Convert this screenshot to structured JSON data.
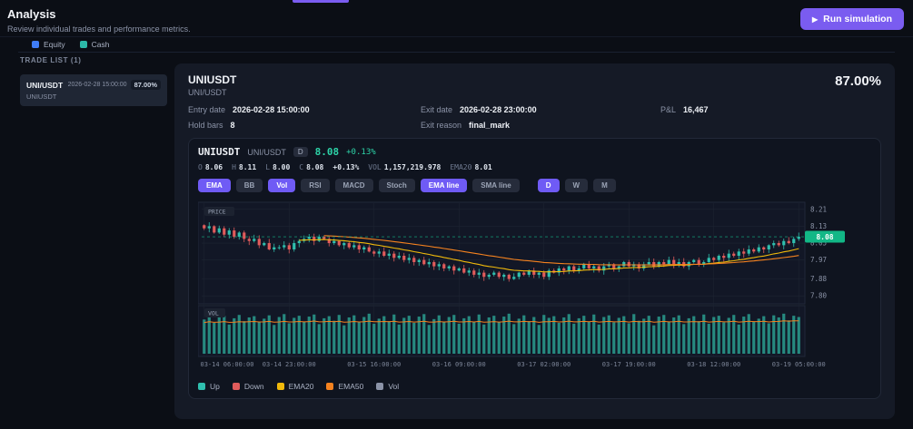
{
  "page": {
    "title": "Analysis",
    "subtitle": "Review individual trades and performance metrics.",
    "run_button_label": "Run simulation",
    "run_button_icon": "▶"
  },
  "equity_legend": [
    {
      "label": "Equity",
      "color": "#3f7df8"
    },
    {
      "label": "Cash",
      "color": "#2cb9a8"
    }
  ],
  "trade_list": {
    "header": "TRADE LIST (1)",
    "items": [
      {
        "symbol": "UNI/USDT",
        "code": "UNIUSDT",
        "datetime": "2026-02-28 15:00:00",
        "pct": "87.00%"
      }
    ]
  },
  "detail": {
    "title": "UNIUSDT",
    "subtitle": "UNI/USDT",
    "pct": "87.00%",
    "fields": [
      {
        "label": "Entry date",
        "value": "2026-02-28 15:00:00"
      },
      {
        "label": "Exit date",
        "value": "2026-02-28 23:00:00"
      },
      {
        "label": "P&L",
        "value": "16,467"
      },
      {
        "label": "Hold bars",
        "value": "8"
      },
      {
        "label": "Exit reason",
        "value": "final_mark"
      },
      {
        "label": "",
        "value": ""
      }
    ]
  },
  "chart": {
    "symbol": "UNIUSDT",
    "pair": "UNI/USDT",
    "timeframe_badge": "D",
    "last_price": "8.08",
    "change": "+0.13%",
    "ohlc_tokens": [
      {
        "k": "O",
        "v": "8.06"
      },
      {
        "k": "H",
        "v": "8.11"
      },
      {
        "k": "L",
        "v": "8.00"
      },
      {
        "k": "C",
        "v": "8.08"
      },
      {
        "k": "",
        "v": "+0.13%"
      },
      {
        "k": "VOL",
        "v": "1,157,219.978"
      },
      {
        "k": "EMA20",
        "v": "8.01"
      }
    ],
    "toolbar": [
      {
        "label": "EMA",
        "active": true
      },
      {
        "label": "BB",
        "active": false
      },
      {
        "label": "Vol",
        "active": true
      },
      {
        "label": "RSI",
        "active": false
      },
      {
        "label": "MACD",
        "active": false
      },
      {
        "label": "Stoch",
        "active": false
      },
      {
        "label": "EMA line",
        "active": true
      },
      {
        "label": "SMA line",
        "active": false
      }
    ],
    "timeframes": [
      {
        "label": "D",
        "active": true
      },
      {
        "label": "W",
        "active": false
      },
      {
        "label": "M",
        "active": false
      }
    ],
    "pane_labels": {
      "price": "PRICE",
      "vol": "VOL"
    },
    "price_tag": "8.08",
    "legend": [
      {
        "label": "Up",
        "color": "#2fbfae"
      },
      {
        "label": "Down",
        "color": "#e05b5b"
      },
      {
        "label": "EMA20",
        "color": "#f0b90b"
      },
      {
        "label": "EMA50",
        "color": "#f5821f"
      },
      {
        "label": "Vol",
        "color": "#8b93a7"
      }
    ]
  },
  "colors": {
    "accent": "#7a5cf0",
    "up": "#2fbfae",
    "down": "#e05b5b",
    "ema20": "#f0b90b",
    "ema50": "#f5821f",
    "vol_bar": "#2a9d8f",
    "price_tag_bg": "#12b786",
    "grid": "#1d2432",
    "axis_text": "#8b93a7",
    "pane_bg": "#121726",
    "pane_border": "#202738"
  },
  "chart_data": {
    "type": "candlestick",
    "title": "UNIUSDT UNI/USDT",
    "timeframe": "1h",
    "y_range": [
      7.78,
      8.24
    ],
    "y_tick_labels": [
      "8.21",
      "8.13",
      "8.05",
      "7.97",
      "7.88",
      "7.80"
    ],
    "x_tick_labels": [
      "03-14 06:00:00",
      "03-14 23:00:00",
      "03-15 16:00:00",
      "03-16 09:00:00",
      "03-17 02:00:00",
      "03-17 19:00:00",
      "03-18 12:00:00",
      "03-19 05:00:00"
    ],
    "x_tick_indices": [
      0,
      17,
      34,
      51,
      68,
      85,
      102,
      119
    ],
    "last_price": 8.08,
    "overlays": [
      "EMA20",
      "EMA50",
      "VolEMA"
    ],
    "closes": [
      8.12,
      8.13,
      8.1,
      8.12,
      8.09,
      8.11,
      8.08,
      8.1,
      8.07,
      8.06,
      8.07,
      8.04,
      8.05,
      8.02,
      8.03,
      8.03,
      8.04,
      8.02,
      8.05,
      8.06,
      8.07,
      8.08,
      8.06,
      8.08,
      8.07,
      8.05,
      8.06,
      8.04,
      8.05,
      8.03,
      8.04,
      8.02,
      8.03,
      8.01,
      8.0,
      8.01,
      7.99,
      8.0,
      7.98,
      7.99,
      7.97,
      7.98,
      7.96,
      7.97,
      7.95,
      7.96,
      7.94,
      7.95,
      7.93,
      7.94,
      7.92,
      7.93,
      7.91,
      7.92,
      7.9,
      7.91,
      7.89,
      7.9,
      7.91,
      7.89,
      7.9,
      7.88,
      7.89,
      7.91,
      7.9,
      7.92,
      7.9,
      7.91,
      7.89,
      7.92,
      7.91,
      7.93,
      7.92,
      7.94,
      7.92,
      7.93,
      7.95,
      7.93,
      7.94,
      7.92,
      7.94,
      7.95,
      7.93,
      7.94,
      7.96,
      7.94,
      7.95,
      7.93,
      7.95,
      7.96,
      7.94,
      7.96,
      7.95,
      7.97,
      7.95,
      7.96,
      7.94,
      7.96,
      7.97,
      7.95,
      7.96,
      7.98,
      7.97,
      7.99,
      7.98,
      8.0,
      7.99,
      8.01,
      8.0,
      8.02,
      8.01,
      8.03,
      8.02,
      8.04,
      8.05,
      8.04,
      8.06,
      8.05,
      8.07,
      8.08
    ],
    "volumes_norm": [
      0.82,
      0.95,
      0.74,
      0.88,
      0.91,
      0.7,
      0.85,
      0.93,
      0.78,
      0.87,
      0.9,
      0.76,
      0.84,
      0.92,
      0.69,
      0.88,
      0.95,
      0.73,
      0.86,
      0.91,
      0.77,
      0.89,
      0.94,
      0.71,
      0.85,
      0.9,
      0.79,
      0.93,
      0.68,
      0.87,
      0.92,
      0.75,
      0.88,
      0.96,
      0.72,
      0.84,
      0.9,
      0.78,
      0.94,
      0.7,
      0.86,
      0.91,
      0.74,
      0.89,
      0.95,
      0.69,
      0.83,
      0.92,
      0.77,
      0.88,
      0.93,
      0.72,
      0.85,
      0.9,
      0.76,
      0.94,
      0.7,
      0.87,
      0.91,
      0.75,
      0.89,
      0.96,
      0.71,
      0.84,
      0.92,
      0.78,
      0.88,
      0.69,
      0.93,
      0.86,
      0.9,
      0.74,
      0.87,
      0.95,
      0.72,
      0.85,
      0.91,
      0.77,
      0.94,
      0.7,
      0.88,
      0.92,
      0.75,
      0.86,
      0.9,
      0.73,
      0.95,
      0.79,
      0.84,
      0.91,
      0.68,
      0.89,
      0.93,
      0.76,
      0.87,
      0.92,
      0.71,
      0.85,
      0.9,
      0.78,
      0.94,
      0.72,
      0.88,
      0.91,
      0.75,
      0.86,
      0.93,
      0.7,
      0.89,
      0.95,
      0.77,
      0.84,
      0.9,
      0.73,
      0.92,
      0.87,
      0.96,
      0.8,
      0.91,
      0.88
    ]
  }
}
